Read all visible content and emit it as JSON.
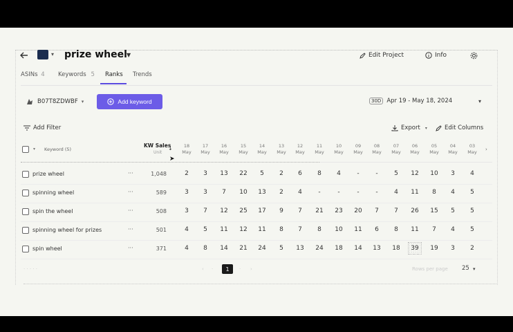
{
  "header": {
    "title": "prize wheel",
    "edit_project": "Edit Project",
    "info": "Info"
  },
  "tabs": [
    {
      "label": "ASINs",
      "count": "4"
    },
    {
      "label": "Keywords",
      "count": "5"
    },
    {
      "label": "Ranks"
    },
    {
      "label": "Trends"
    }
  ],
  "toolbar": {
    "asin": "B07T8ZDWBF",
    "add_keyword": "Add keyword",
    "date_badge": "30D",
    "date_range": "Apr 19 - May 18, 2024",
    "add_filter": "Add Filter",
    "export": "Export",
    "edit_columns": "Edit Columns"
  },
  "table": {
    "col_keyword": "Keyword (5)",
    "col_sales": "KW Sales",
    "col_sales_sub": "Unit",
    "date_cols": [
      "18 May",
      "17 May",
      "16 May",
      "15 May",
      "14 May",
      "13 May",
      "12 May",
      "11 May",
      "10 May",
      "09 May",
      "08 May",
      "07 May",
      "06 May",
      "05 May",
      "04 May",
      "03 May"
    ],
    "rows": [
      {
        "keyword": "prize wheel",
        "sales": "1,048",
        "ranks": [
          "2",
          "3",
          "13",
          "22",
          "5",
          "2",
          "6",
          "8",
          "4",
          "-",
          "-",
          "5",
          "12",
          "10",
          "3",
          "4"
        ]
      },
      {
        "keyword": "spinning wheel",
        "sales": "589",
        "ranks": [
          "3",
          "3",
          "7",
          "10",
          "13",
          "2",
          "4",
          "-",
          "-",
          "-",
          "-",
          "4",
          "11",
          "8",
          "4",
          "5"
        ]
      },
      {
        "keyword": "spin the wheel",
        "sales": "508",
        "ranks": [
          "3",
          "7",
          "12",
          "25",
          "17",
          "9",
          "7",
          "21",
          "23",
          "20",
          "7",
          "7",
          "26",
          "15",
          "5",
          "5"
        ]
      },
      {
        "keyword": "spinning wheel for prizes",
        "sales": "501",
        "ranks": [
          "4",
          "5",
          "11",
          "12",
          "11",
          "8",
          "7",
          "8",
          "10",
          "11",
          "6",
          "8",
          "11",
          "7",
          "4",
          "5"
        ]
      },
      {
        "keyword": "spin wheel",
        "sales": "371",
        "ranks": [
          "4",
          "8",
          "14",
          "21",
          "24",
          "5",
          "13",
          "24",
          "18",
          "14",
          "13",
          "18",
          "39",
          "19",
          "3",
          "2"
        ]
      }
    ]
  },
  "pagination": {
    "current_page": "1",
    "rows_per_page_label": "Rows per page",
    "rows_per_page": "25"
  }
}
